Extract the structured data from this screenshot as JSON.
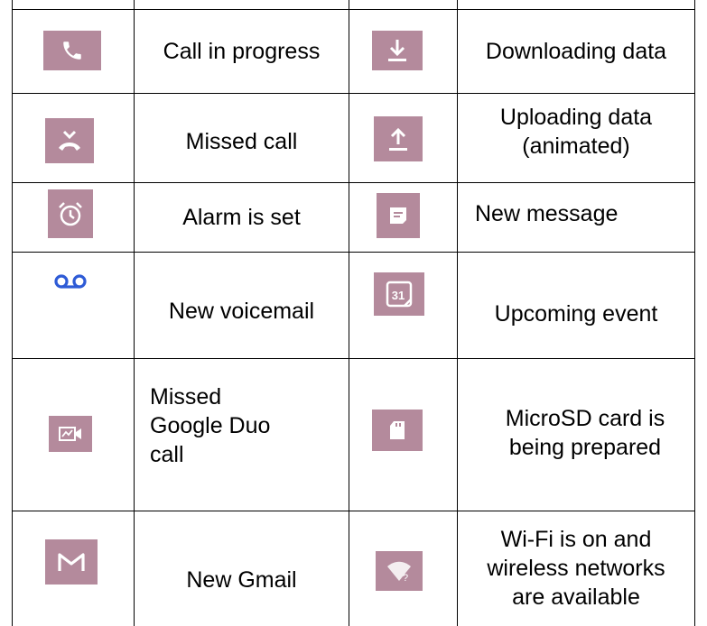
{
  "rows": [
    {
      "left": {
        "icon": "phone-icon",
        "label": "Call in progress"
      },
      "right": {
        "icon": "download-icon",
        "label": "Downloading data"
      }
    },
    {
      "left": {
        "icon": "missed-call-icon",
        "label": "Missed call"
      },
      "right": {
        "icon": "upload-icon",
        "label": "Uploading data (animated)",
        "lines": [
          "Uploading data",
          "(animated)"
        ]
      }
    },
    {
      "left": {
        "icon": "alarm-clock-icon",
        "label": "Alarm is set"
      },
      "right": {
        "icon": "message-icon",
        "label": "New message"
      }
    },
    {
      "left": {
        "icon": "voicemail-icon",
        "label": "New voicemail"
      },
      "right": {
        "icon": "calendar-icon",
        "label": "Upcoming event",
        "calendar_day": "31"
      }
    },
    {
      "left": {
        "icon": "video-call-icon",
        "label": "Missed Google Duo call",
        "lines": [
          "Missed",
          "Google Duo",
          "call"
        ]
      },
      "right": {
        "icon": "sd-card-icon",
        "label": "MicroSD card is being prepared",
        "lines": [
          "MicroSD card is",
          "being prepared"
        ]
      }
    },
    {
      "left": {
        "icon": "gmail-icon",
        "label": "New Gmail"
      },
      "right": {
        "icon": "wifi-question-icon",
        "label": "Wi-Fi is on and wireless networks are available",
        "lines": [
          "Wi-Fi is on and",
          "wireless networks",
          "are available"
        ]
      }
    }
  ],
  "colors": {
    "icon_bg": "#b48a9c",
    "icon_fg": "#ffffff",
    "voicemail": "#2e5bd6",
    "border": "#000000"
  }
}
